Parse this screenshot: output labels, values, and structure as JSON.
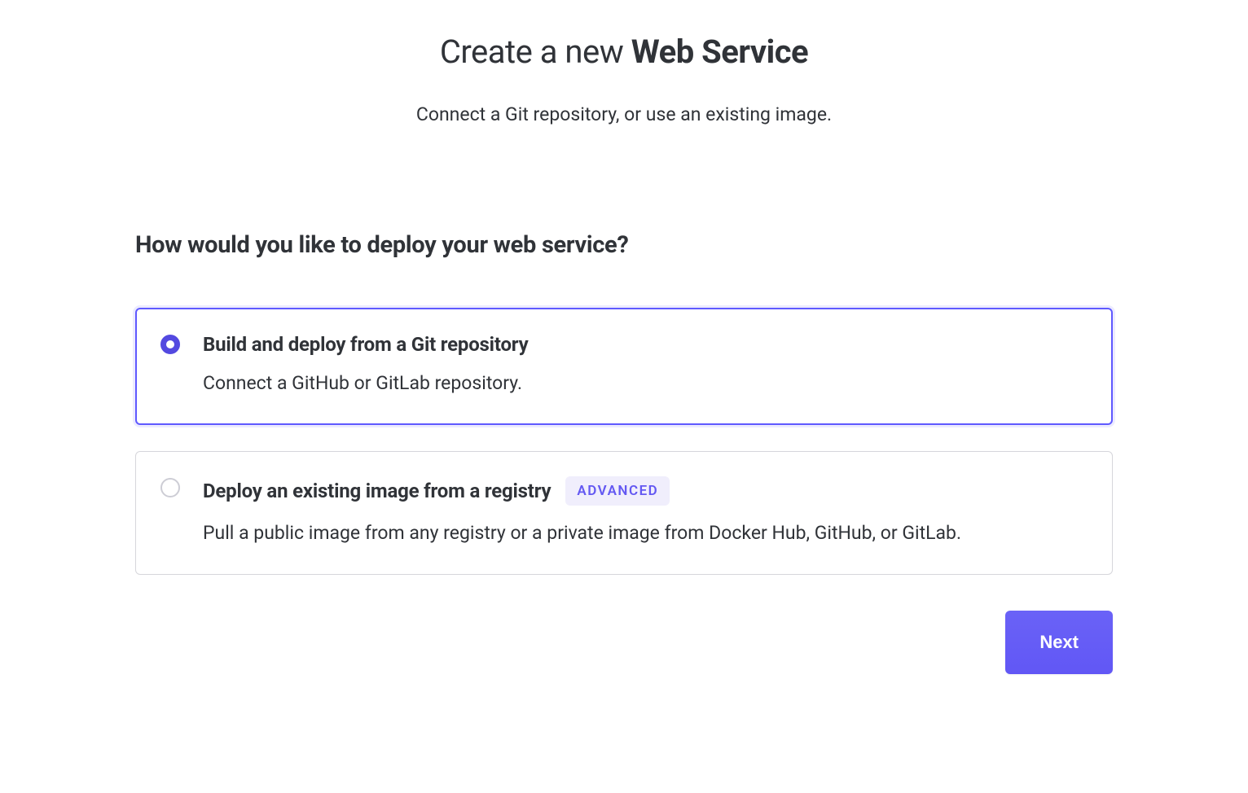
{
  "header": {
    "title_prefix": "Create a new ",
    "title_bold": "Web Service",
    "subtitle": "Connect a Git repository, or use an existing image."
  },
  "section": {
    "heading": "How would you like to deploy your web service?"
  },
  "options": [
    {
      "title": "Build and deploy from a Git repository",
      "description": "Connect a GitHub or GitLab repository.",
      "selected": true,
      "badge": null
    },
    {
      "title": "Deploy an existing image from a registry",
      "description": "Pull a public image from any registry or a private image from Docker Hub, GitHub, or GitLab.",
      "selected": false,
      "badge": "ADVANCED"
    }
  ],
  "footer": {
    "next_label": "Next"
  }
}
